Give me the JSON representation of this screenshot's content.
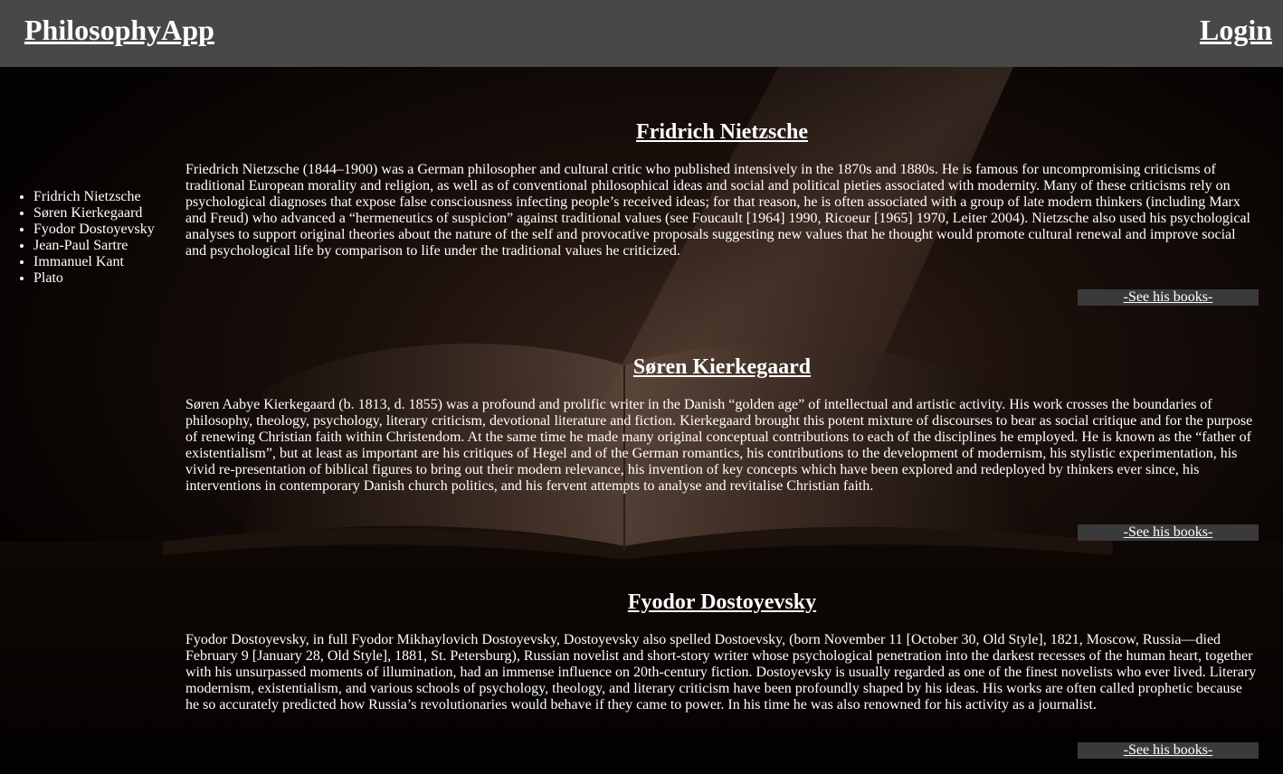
{
  "header": {
    "brand": "PhilosophyApp",
    "login_label": "Login"
  },
  "sidebar": {
    "items": [
      {
        "label": "Fridrich Nietzsche"
      },
      {
        "label": "Søren Kierkegaard"
      },
      {
        "label": "Fyodor Dostoyevsky"
      },
      {
        "label": "Jean-Paul Sartre"
      },
      {
        "label": "Immanuel Kant"
      },
      {
        "label": "Plato"
      }
    ]
  },
  "entries": [
    {
      "title": "Fridrich Nietzsche",
      "text": "Friedrich Nietzsche (1844–1900) was a German philosopher and cultural critic who published intensively in the 1870s and 1880s. He is famous for uncompromising criticisms of traditional European morality and religion, as well as of conventional philosophical ideas and social and political pieties associated with modernity. Many of these criticisms rely on psychological diagnoses that expose false consciousness infecting people’s received ideas; for that reason, he is often associated with a group of late modern thinkers (including Marx and Freud) who advanced a “hermeneutics of suspicion” against traditional values (see Foucault [1964] 1990, Ricoeur [1965] 1970, Leiter 2004). Nietzsche also used his psychological analyses to support original theories about the nature of the self and provocative proposals suggesting new values that he thought would promote cultural renewal and improve social and psychological life by comparison to life under the traditional values he criticized.",
      "books_label": "-See his books-"
    },
    {
      "title": "Søren Kierkegaard",
      "text": "Søren Aabye Kierkegaard (b. 1813, d. 1855) was a profound and prolific writer in the Danish “golden age” of intellectual and artistic activity. His work crosses the boundaries of philosophy, theology, psychology, literary criticism, devotional literature and fiction. Kierkegaard brought this potent mixture of discourses to bear as social critique and for the purpose of renewing Christian faith within Christendom. At the same time he made many original conceptual contributions to each of the disciplines he employed. He is known as the “father of existentialism”, but at least as important are his critiques of Hegel and of the German romantics, his contributions to the development of modernism, his stylistic experimentation, his vivid re-presentation of biblical figures to bring out their modern relevance, his invention of key concepts which have been explored and redeployed by thinkers ever since, his interventions in contemporary Danish church politics, and his fervent attempts to analyse and revitalise Christian faith.",
      "books_label": "-See his books-"
    },
    {
      "title": "Fyodor Dostoyevsky",
      "text": "Fyodor Dostoyevsky, in full Fyodor Mikhaylovich Dostoyevsky, Dostoyevsky also spelled Dostoevsky, (born November 11 [October 30, Old Style], 1821, Moscow, Russia—died February 9 [January 28, Old Style], 1881, St. Petersburg), Russian novelist and short-story writer whose psychological penetration into the darkest recesses of the human heart, together with his unsurpassed moments of illumination, had an immense influence on 20th-century fiction. Dostoyevsky is usually regarded as one of the finest novelists who ever lived. Literary modernism, existentialism, and various schools of psychology, theology, and literary criticism have been profoundly shaped by his ideas. His works are often called prophetic because he so accurately predicted how Russia’s revolutionaries would behave if they came to power. In his time he was also renowned for his activity as a journalist.",
      "books_label": "-See his books-"
    }
  ],
  "theme": {
    "topbar_bg": "#484848",
    "button_bg": "#3a3a3a",
    "page_bg": "#070403"
  }
}
